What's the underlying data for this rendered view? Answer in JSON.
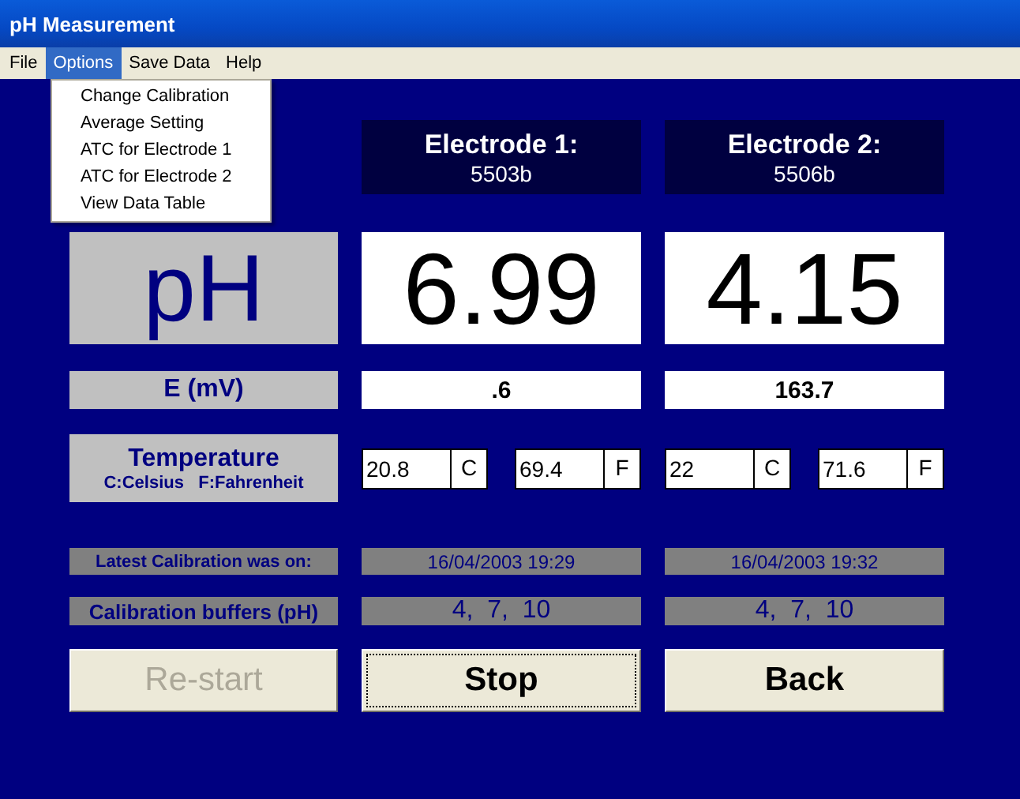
{
  "window": {
    "title": "pH Measurement"
  },
  "menu": [
    {
      "label": "File",
      "selected": false
    },
    {
      "label": "Options",
      "selected": true
    },
    {
      "label": "Save Data",
      "selected": false
    },
    {
      "label": "Help",
      "selected": false
    }
  ],
  "dropdown": [
    "Change Calibration",
    "Average Setting",
    "ATC for Electrode 1",
    "ATC for Electrode 2",
    "View Data Table"
  ],
  "labels": {
    "ph": "pH",
    "mv": "E (mV)",
    "temperature": "Temperature",
    "temperature_units": "C:Celsius   F:Fahrenheit",
    "calibration": "Latest Calibration was on:",
    "buffers": "Calibration buffers (pH)"
  },
  "electrodes": [
    {
      "name": "Electrode 1:",
      "id": "5503b",
      "ph": "6.99",
      "mv": ".6",
      "temp_c": "20.8",
      "unit_c": "C",
      "temp_f": "69.4",
      "unit_f": "F",
      "calibration": "16/04/2003 19:29",
      "buffers": "4,  7,  10"
    },
    {
      "name": "Electrode 2:",
      "id": "5506b",
      "ph": "4.15",
      "mv": "163.7",
      "temp_c": "22",
      "unit_c": "C",
      "temp_f": "71.6",
      "unit_f": "F",
      "calibration": "16/04/2003 19:32",
      "buffers": "4,  7,  10"
    }
  ],
  "buttons": [
    {
      "label": "Re-start",
      "disabled": true,
      "focused": false
    },
    {
      "label": "Stop",
      "disabled": false,
      "focused": true
    },
    {
      "label": "Back",
      "disabled": false,
      "focused": false
    }
  ]
}
